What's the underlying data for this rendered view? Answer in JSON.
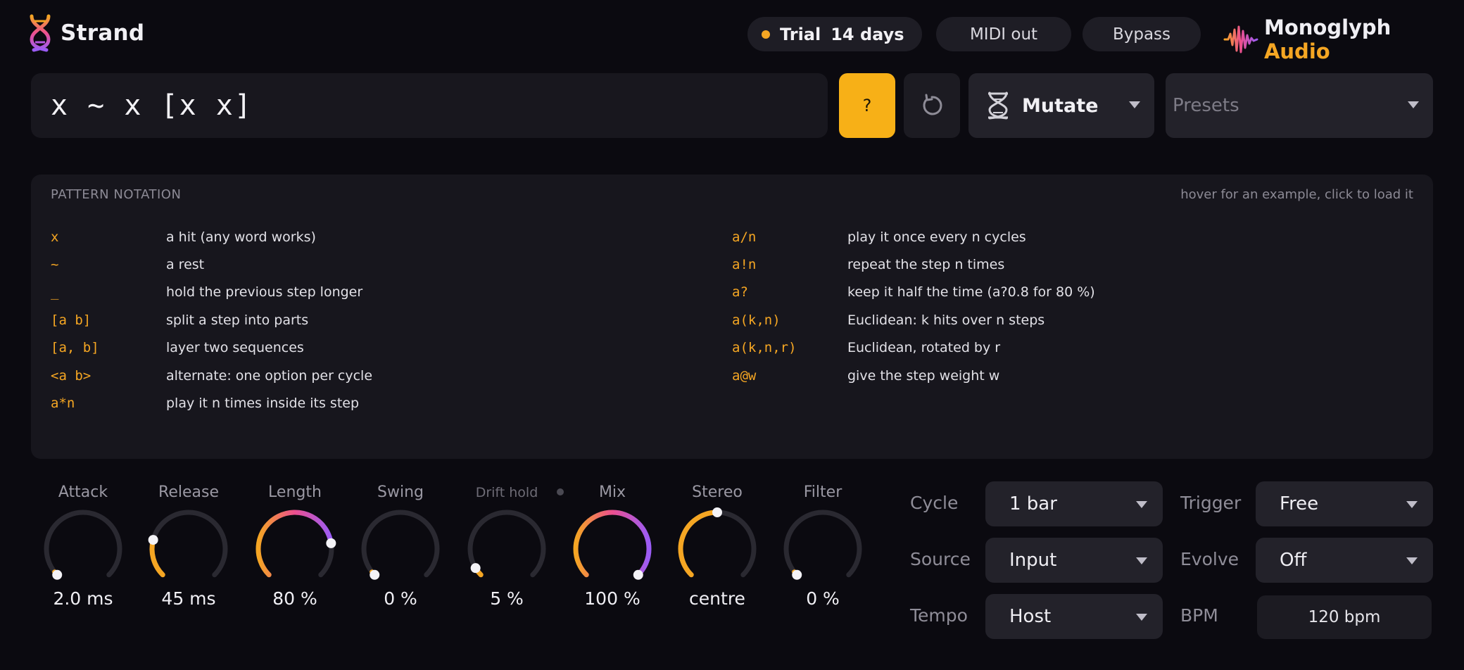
{
  "app": {
    "name": "Strand"
  },
  "header": {
    "trial_label": "Trial",
    "trial_days": "14 days",
    "midi_out": "MIDI out",
    "bypass": "Bypass",
    "brand_main": "Monoglyph",
    "brand_accent": "Audio"
  },
  "colors": {
    "accent": "#f5a623",
    "gradient_start": "#f5a623",
    "gradient_mid": "#ec4f8f",
    "gradient_end": "#9b5cf6"
  },
  "pattern": {
    "text": "x ~ x [x x]"
  },
  "toolbar": {
    "help_label": "?",
    "reset_icon": "reset-icon",
    "mutate_label": "Mutate",
    "presets_placeholder": "Presets"
  },
  "notation": {
    "title": "PATTERN NOTATION",
    "hint": "hover for an example, click to load it",
    "left": [
      {
        "code": "x",
        "desc": "a hit (any word works)"
      },
      {
        "code": "~",
        "desc": "a rest"
      },
      {
        "code": "_",
        "desc": "hold the previous step longer"
      },
      {
        "code": "[a b]",
        "desc": "split a step into parts"
      },
      {
        "code": "[a, b]",
        "desc": "layer two sequences"
      },
      {
        "code": "<a b>",
        "desc": "alternate: one option per cycle"
      },
      {
        "code": "a*n",
        "desc": "play it n times inside its step"
      }
    ],
    "right": [
      {
        "code": "a/n",
        "desc": "play it once every n cycles"
      },
      {
        "code": "a!n",
        "desc": "repeat the step n times"
      },
      {
        "code": "a?",
        "desc": "keep it half the time (a?0.8 for 80 %)"
      },
      {
        "code": "a(k,n)",
        "desc": "Euclidean: k hits over n steps"
      },
      {
        "code": "a(k,n,r)",
        "desc": "Euclidean, rotated by r"
      },
      {
        "code": "a@w",
        "desc": "give the step weight w"
      }
    ]
  },
  "knobs": [
    {
      "label": "Attack",
      "value": "2.0 ms",
      "level": 0.0,
      "gradient": false
    },
    {
      "label": "Release",
      "value": "45 ms",
      "level": 0.22,
      "gradient": false
    },
    {
      "label": "Length",
      "value": "80 %",
      "level": 0.8,
      "gradient": true
    },
    {
      "label": "Swing",
      "value": "0 %",
      "level": 0.0,
      "gradient": false
    },
    {
      "label": "Drift hold",
      "value": "5 %",
      "level": 0.05,
      "gradient": false
    },
    {
      "label": "Mix",
      "value": "100 %",
      "level": 1.0,
      "gradient": true
    },
    {
      "label": "Stereo",
      "value": "centre",
      "level": 0.5,
      "gradient": false
    },
    {
      "label": "Filter",
      "value": "0 %",
      "level": 0.0,
      "gradient": false
    }
  ],
  "controls": {
    "cycle": {
      "label": "Cycle",
      "value": "1 bar"
    },
    "trigger": {
      "label": "Trigger",
      "value": "Free"
    },
    "source": {
      "label": "Source",
      "value": "Input"
    },
    "evolve": {
      "label": "Evolve",
      "value": "Off"
    },
    "tempo": {
      "label": "Tempo",
      "value": "Host"
    },
    "bpm": {
      "label": "BPM",
      "value": "120 bpm"
    }
  }
}
